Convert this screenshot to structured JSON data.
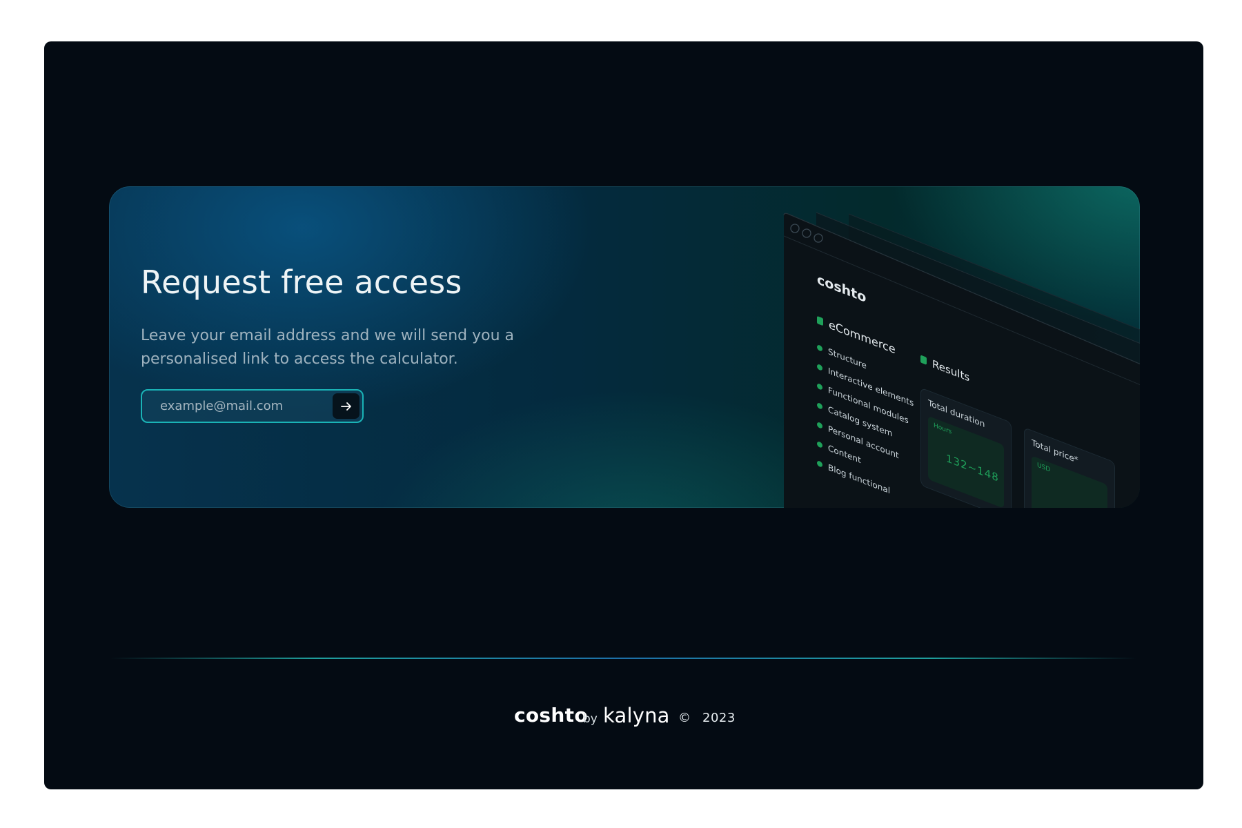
{
  "request_card": {
    "title": "Request free access",
    "subtitle": "Leave your email address and we will send you a personalised link to access the calculator.",
    "email_placeholder": "example@mail.com",
    "submit_icon": "arrow-right-icon"
  },
  "mockup": {
    "logo": "coshto",
    "section_title": "eCommerce",
    "items": [
      "Structure",
      "Interactive elements",
      "Functional modules",
      "Catalog system",
      "Personal account",
      "Content",
      "Blog functional"
    ],
    "results_title": "Results",
    "metrics": [
      {
        "label": "Total duration",
        "unit": "Hours",
        "value": "132~148"
      },
      {
        "label": "Total price*",
        "unit": "USD",
        "value": ""
      }
    ]
  },
  "footer": {
    "brand": "coshto",
    "by": "by",
    "partner": "kalyna",
    "copyright_symbol": "©",
    "year": "2023"
  },
  "colors": {
    "frame_bg": "#040b13",
    "accent_teal": "#1ab3b6",
    "accent_green": "#1fa05a"
  }
}
